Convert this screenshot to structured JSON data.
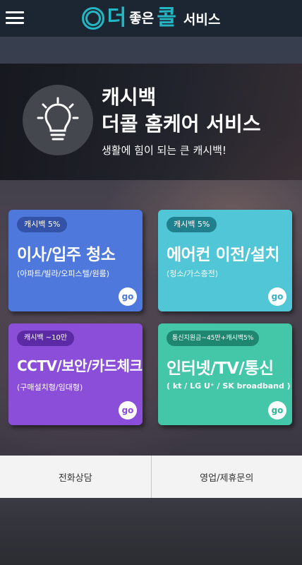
{
  "header": {
    "menu_icon": "hamburger-menu-icon",
    "logo_icon": "concentric-circles-logo-icon",
    "logo_main": "더",
    "logo_small": "좋은",
    "logo_main2": "콜",
    "logo_sub": "서비스",
    "accent": "#23b7c3",
    "background": "#1c2633"
  },
  "hero": {
    "icon": "lightbulb-icon",
    "title_line1": "캐시백",
    "title_line2": "더콜 홈케어 서비스",
    "subtitle": "생활에 힘이 되는 큰 캐시백!"
  },
  "cards": [
    {
      "badge": "캐시백 5%",
      "title": "이사/입주 청소",
      "subtitle": "(아파트/빌라/오피스텔/원룸)",
      "go": "go",
      "color": "#4f78dc"
    },
    {
      "badge": "캐시백 5%",
      "title": "에어컨 이전/설치",
      "subtitle": "(청소/가스충전)",
      "go": "go",
      "color": "#50c6d6"
    },
    {
      "badge": "캐시백 ~10만",
      "title": "CCTV/보안/카드체크",
      "subtitle": "(구매설치형/임대형)",
      "go": "go",
      "color": "#8b4ed8"
    },
    {
      "badge": "통신지원금~45만+캐시백5%",
      "title": "인터넷/TV/통신",
      "subtitle": "( kt / LG U⁺ / SK broadband )",
      "go": "go",
      "color": "#44c7a8"
    }
  ],
  "bottom": {
    "left_label": "전화상담",
    "right_label": "영업/제휴문의"
  }
}
